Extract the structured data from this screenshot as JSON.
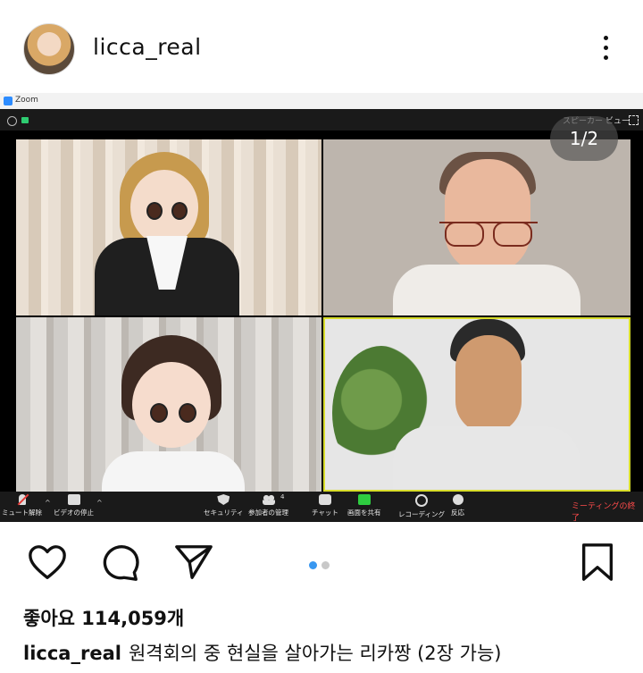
{
  "post": {
    "username": "licca_real",
    "likes_text": "좋아요 114,059개",
    "caption_text": "원격회의 중 현실을 살아가는 리카짱 (2장 가능)",
    "carousel": {
      "current": 1,
      "total": 2
    }
  },
  "zoom": {
    "title": "Zoom",
    "speaker_view": "スピーカー ビュー",
    "page_indicator": "1/2",
    "participants_count": "4",
    "toolbar": {
      "mute": "ミュート解除",
      "video": "ビデオの停止",
      "security": "セキュリティ",
      "participants": "参加者の管理",
      "chat": "チャット",
      "share": "画面を共有",
      "record": "レコーディング",
      "reactions": "反応",
      "end": "ミーティングの終了"
    }
  },
  "icons": {
    "more": "more-vertical-icon",
    "like": "heart-icon",
    "comment": "comment-icon",
    "share": "send-icon",
    "save": "bookmark-icon"
  },
  "colors": {
    "carousel_active": "#3897f0",
    "end_meeting": "#ff4b4b",
    "active_speaker_border": "#d8dd2b",
    "share_green": "#2ecc40"
  }
}
